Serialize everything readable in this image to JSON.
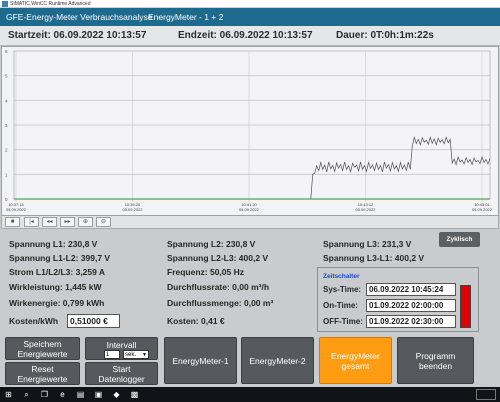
{
  "window": {
    "title": "SIMATIC WinCC Runtime Advanced"
  },
  "header": {
    "app_title": "GFE-Energy-Meter Verbrauchsanalyse",
    "meter_title": "EnergyMeter - 1 + 2"
  },
  "timebar": {
    "start": "Startzeit: 06.09.2022 10:13:57",
    "end": "Endzeit: 06.09.2022 10:13:57",
    "duration": "Dauer: 0T:0h:1m:22s"
  },
  "chart_data": {
    "type": "line",
    "ylim": [
      0,
      6
    ],
    "y_ticks": [
      "6",
      "5",
      "4",
      "3",
      "2",
      "1",
      "0"
    ],
    "x_ticks": [
      {
        "time": "10:37:15",
        "date": "05.09.2022"
      },
      {
        "time": "10:39:20",
        "date": "05.09.2022"
      },
      {
        "time": "10:41:20",
        "date": "05.09.2022"
      },
      {
        "time": "10:43:12",
        "date": "05.09.2022"
      },
      {
        "time": "10:45:01",
        "date": "05.09.2022"
      }
    ],
    "series": [
      {
        "color": "#505050",
        "values": [
          0,
          0,
          0,
          0,
          0,
          0,
          0,
          0,
          0,
          0,
          0,
          0,
          0,
          0,
          0,
          0,
          0,
          0,
          0,
          0,
          0,
          0,
          0,
          0,
          0,
          0,
          0,
          0,
          0,
          0,
          0,
          0,
          0,
          0,
          0,
          0,
          0,
          0,
          0,
          0,
          0,
          0,
          0,
          0,
          0,
          0,
          0,
          0,
          0,
          0,
          0,
          0,
          0,
          0,
          0,
          0,
          0,
          0,
          0,
          0,
          0,
          0,
          0,
          0,
          0,
          0,
          0,
          0,
          0,
          0,
          0,
          0,
          0,
          0,
          0,
          0,
          0,
          0,
          0,
          0,
          0,
          0,
          0,
          0,
          0,
          0,
          0,
          0,
          0,
          0,
          0,
          0,
          0,
          0,
          0,
          0,
          0,
          0,
          0,
          0,
          0,
          0,
          0,
          0,
          0,
          0,
          0,
          0,
          0,
          0,
          0,
          0,
          0,
          0,
          0,
          0,
          0,
          0,
          0,
          0,
          0,
          0,
          0,
          0,
          0,
          0,
          0,
          0,
          0,
          0,
          0,
          0,
          0,
          0,
          0,
          0,
          0,
          0,
          0,
          0,
          0,
          0,
          0,
          0,
          0,
          0,
          0,
          0,
          0,
          0,
          1.0,
          1.05,
          1.35,
          1.15,
          1.48,
          1.2,
          1.38,
          1.1,
          1.5,
          1.22,
          1.36,
          1.12,
          1.46,
          1.25,
          1.4,
          1.15,
          1.5,
          1.2,
          1.35,
          1.1,
          1.45,
          1.28,
          1.38,
          1.14,
          1.5,
          1.2,
          1.36,
          1.12,
          1.48,
          1.24,
          1.38,
          1.15,
          1.46,
          1.2,
          1.36,
          1.1,
          1.5,
          1.25,
          1.4,
          1.14,
          1.47,
          1.22,
          1.35,
          1.12,
          1.48,
          1.22,
          1.38,
          1.16,
          1.5,
          1.2,
          2.15,
          2.5,
          2.25,
          2.42,
          2.2,
          2.48,
          2.3,
          2.38,
          2.22,
          2.5,
          2.26,
          2.44,
          2.2,
          2.46,
          2.3,
          2.4,
          2.24,
          2.5,
          2.28,
          2.42,
          1.45,
          1.62,
          1.4,
          1.7,
          1.5,
          1.58,
          1.42,
          1.68,
          1.48,
          1.6,
          1.4,
          1.66,
          1.5,
          1.56,
          1.44,
          1.7,
          1.48,
          1.6,
          1.42,
          1.64
        ]
      },
      {
        "color": "#2e8b3a",
        "values": [
          0,
          0,
          0,
          0,
          0,
          0,
          0,
          0,
          0,
          0,
          0,
          0,
          0,
          0,
          0,
          0,
          0,
          0,
          0,
          0,
          0,
          0,
          0,
          0,
          0,
          0,
          0,
          0,
          0,
          0,
          0,
          0,
          0,
          0,
          0,
          0,
          0,
          0,
          0,
          0,
          0,
          0,
          0,
          0,
          0,
          0,
          0,
          0,
          0,
          0,
          0,
          0,
          0,
          0,
          0,
          0,
          0,
          0,
          0,
          0,
          0,
          0,
          0,
          0,
          0,
          0,
          0,
          0,
          0,
          0,
          0,
          0,
          0,
          0,
          0,
          0,
          0,
          0,
          0,
          0,
          0,
          0,
          0,
          0,
          0,
          0,
          0,
          0,
          0,
          0,
          0,
          0,
          0,
          0,
          0,
          0,
          0,
          0,
          0,
          0,
          0,
          0,
          0,
          0,
          0,
          0,
          0,
          0,
          0,
          0,
          0,
          0,
          0,
          0,
          0,
          0,
          0,
          0,
          0,
          0,
          0,
          0,
          0,
          0,
          0,
          0,
          0,
          0,
          0,
          0,
          0,
          0,
          0,
          0,
          0,
          0,
          0,
          0,
          0,
          0,
          0,
          0,
          0,
          0,
          0,
          0,
          0,
          0,
          0,
          0,
          0,
          0,
          0,
          0,
          0,
          0,
          0,
          0,
          0,
          0,
          0,
          0,
          0,
          0,
          0,
          0,
          0,
          0,
          0,
          0,
          0,
          0,
          0,
          0,
          0,
          0,
          0,
          0,
          0,
          0,
          0,
          0,
          0,
          0,
          0,
          0,
          0,
          0,
          0,
          0,
          0,
          0,
          0,
          0,
          0,
          0,
          0,
          0,
          0,
          0,
          0,
          0,
          0,
          0,
          0,
          0,
          0,
          0,
          0,
          0,
          0,
          0,
          0,
          0,
          0,
          0,
          0,
          0,
          0,
          0,
          0,
          0,
          0,
          0,
          0,
          0,
          0,
          0,
          0,
          0,
          0,
          0,
          0,
          0,
          0,
          0,
          0,
          0,
          0,
          0
        ]
      }
    ]
  },
  "toolbar": {
    "buttons": [
      {
        "name": "stop-icon",
        "glyph": "■"
      },
      {
        "name": "first-icon",
        "glyph": "|◂"
      },
      {
        "name": "rewind-icon",
        "glyph": "◂◂"
      },
      {
        "name": "forward-icon",
        "glyph": "▸▸"
      },
      {
        "name": "zoom-in-icon",
        "glyph": "⊕"
      },
      {
        "name": "zoom-out-icon",
        "glyph": "⊖"
      }
    ]
  },
  "zyklisch_label": "Zyklisch",
  "measurements": {
    "spannung_l1": "Spannung L1: 230,8 V",
    "spannung_l2": "Spannung L2: 230,8 V",
    "spannung_l3": "Spannung L3: 231,3 V",
    "spannung_l1_l2": "Spannung L1-L2: 399,7 V",
    "spannung_l2_l3": "Spannung L2-L3: 400,2 V",
    "spannung_l3_l1": "Spannung L3-L1: 400,2 V",
    "strom": "Strom L1/L2/L3: 3,259 A",
    "frequenz": "Frequenz: 50,05 Hz",
    "wirkleistung": "Wirkleistung: 1,445 kW",
    "durchflussrate": "Durchflussrate: 0,00  m³/h",
    "wirkenergie": "Wirkenergie: 0,799 kWh",
    "durchflussmenge": "Durchflussmenge: 0,00 m³",
    "kosten_per_kwh_label": "Kosten/kWh",
    "kosten_per_kwh_value": "0,51000 €",
    "kosten": "Kosten: 0,41 €"
  },
  "zeitschalter": {
    "title": "Zeitschalter",
    "sys_label": "Sys-Time:",
    "sys_value": "06.09.2022 10:45:24",
    "on_label": "On-Time:",
    "on_value": "01.09.2022 02:00:00",
    "off_label": "OFF-Time:",
    "off_value": "01.09.2022 02:30:00",
    "indicator_color": "#e00000"
  },
  "buttons": {
    "speichern": "Speichern\nEnergiewerte",
    "reset": "Reset\nEnergiewerte",
    "intervall_label": "Intervall",
    "intervall_value": "1",
    "intervall_unit": "sek.",
    "start_logger": "Start\nDatenlogger",
    "em1": "EnergyMeter-1",
    "em2": "EnergyMeter-2",
    "em_gesamt": "EnergyMeter\ngesamt",
    "beenden": "Programm\nbeenden"
  }
}
